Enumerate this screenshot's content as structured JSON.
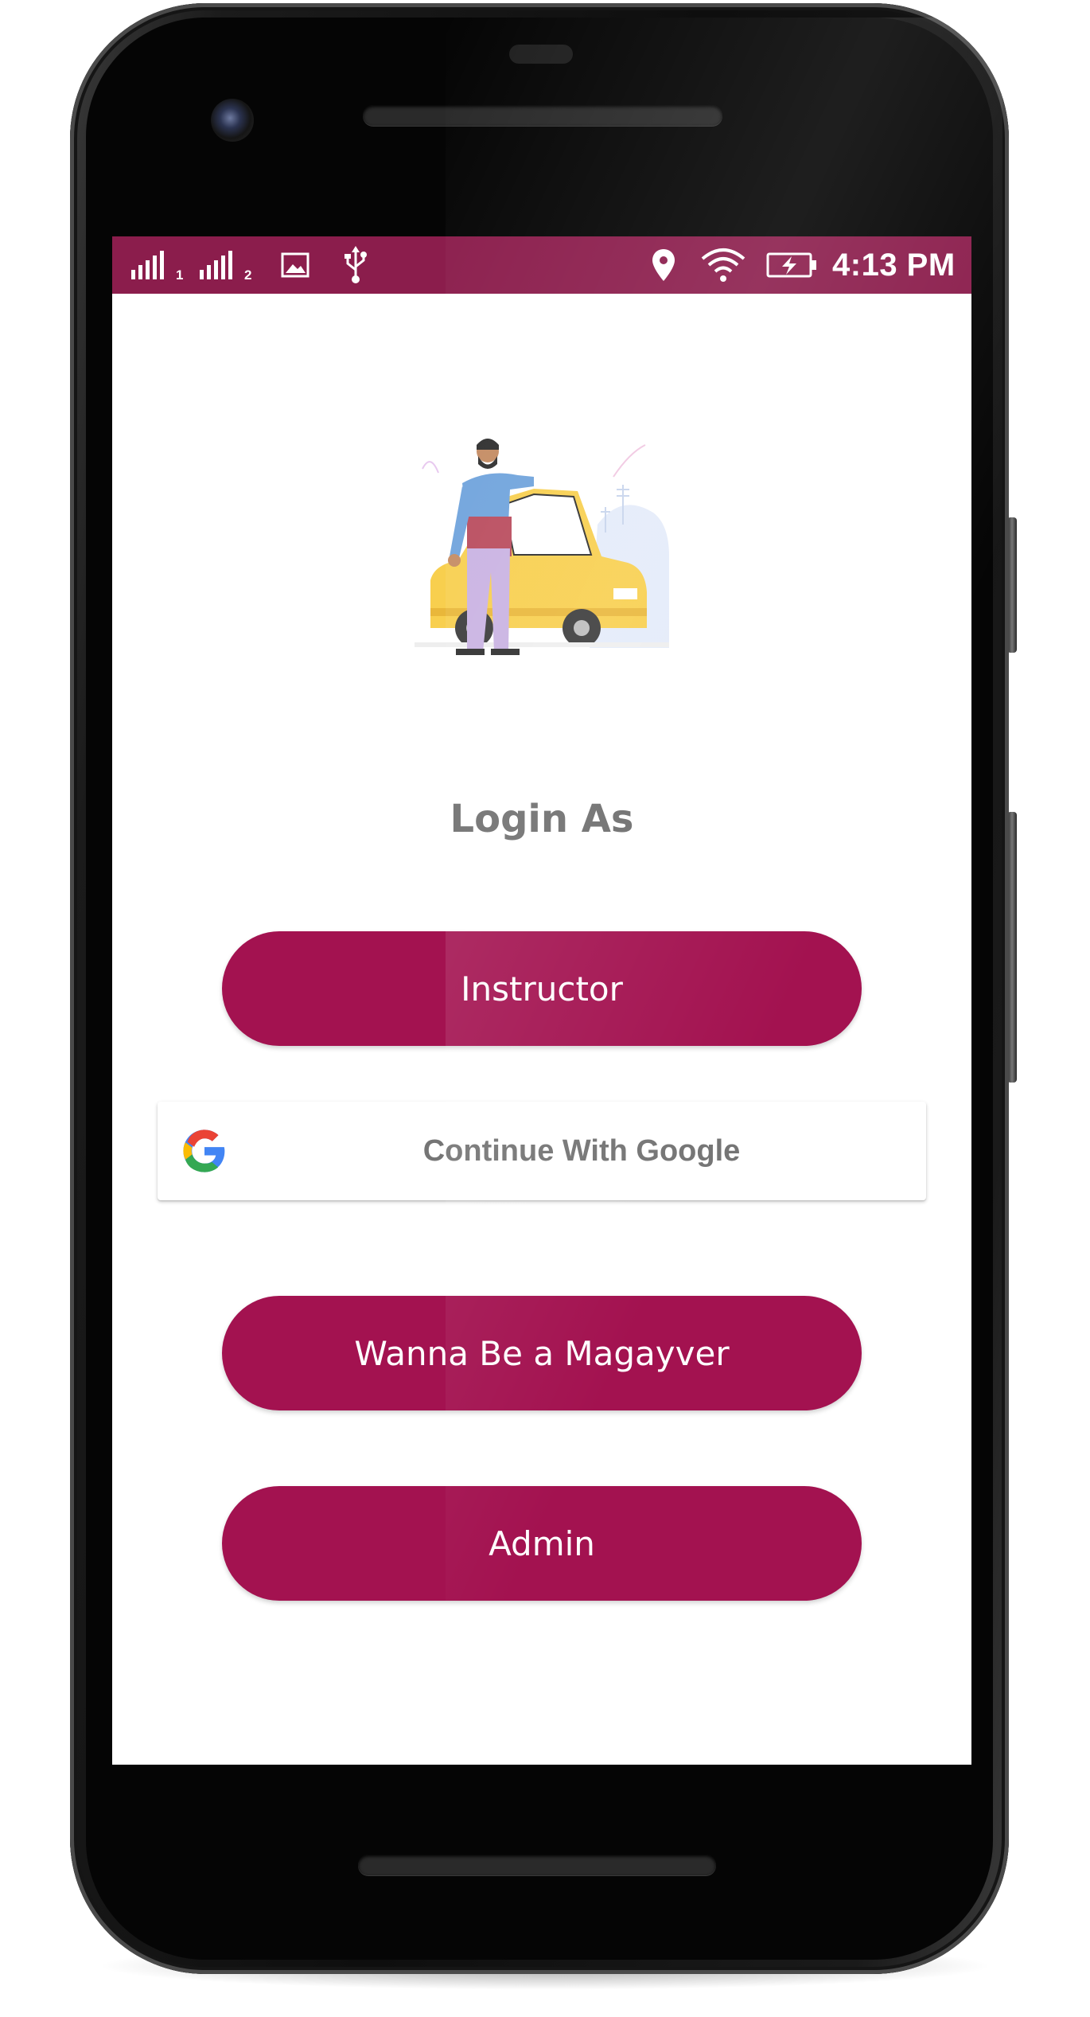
{
  "status_bar": {
    "sim1": "1",
    "sim2": "2",
    "time": "4:13 PM",
    "icons": [
      "signal-icon",
      "signal-icon",
      "gallery-icon",
      "usb-icon",
      "location-icon",
      "wifi-icon",
      "battery-charging-icon"
    ]
  },
  "login": {
    "title": "Login As",
    "instructor_label": "Instructor",
    "google_label": "Continue With Google",
    "magayver_label": "Wanna Be a Magayver",
    "admin_label": "Admin"
  },
  "colors": {
    "status_bar": "#8b1d4c",
    "primary_button": "#a31250",
    "title_text": "#6d6d6d",
    "google_text": "#757575"
  }
}
